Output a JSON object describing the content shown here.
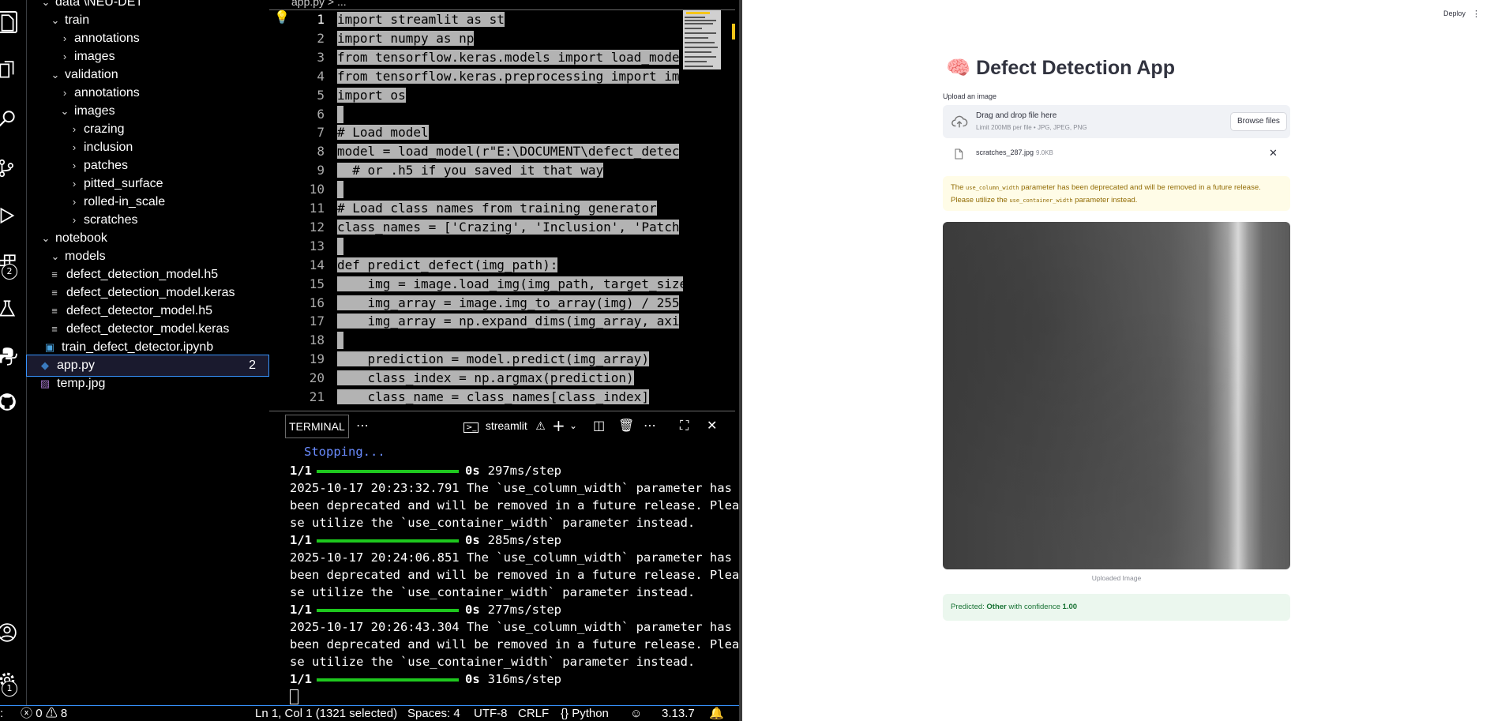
{
  "explorer": {
    "items": [
      {
        "label": "data \\NEU-DET",
        "type": "folder-open"
      },
      {
        "label": "train",
        "type": "folder-open"
      },
      {
        "label": "annotations",
        "type": "folder"
      },
      {
        "label": "images",
        "type": "folder"
      },
      {
        "label": "validation",
        "type": "folder-open"
      },
      {
        "label": "annotations",
        "type": "folder"
      },
      {
        "label": "images",
        "type": "folder-open"
      },
      {
        "label": "crazing",
        "type": "folder"
      },
      {
        "label": "inclusion",
        "type": "folder"
      },
      {
        "label": "patches",
        "type": "folder"
      },
      {
        "label": "pitted_surface",
        "type": "folder"
      },
      {
        "label": "rolled-in_scale",
        "type": "folder"
      },
      {
        "label": "scratches",
        "type": "folder"
      },
      {
        "label": "notebook",
        "type": "folder-open"
      },
      {
        "label": "models",
        "type": "folder-open"
      },
      {
        "label": "defect_detection_model.h5",
        "type": "file"
      },
      {
        "label": "defect_detection_model.keras",
        "type": "file"
      },
      {
        "label": "defect_detector_model.h5",
        "type": "file"
      },
      {
        "label": "defect_detector_model.keras",
        "type": "file"
      },
      {
        "label": "train_defect_detector.ipynb",
        "type": "notebook"
      },
      {
        "label": "app.py",
        "type": "python",
        "badge": "2"
      },
      {
        "label": "temp.jpg",
        "type": "image"
      }
    ]
  },
  "activity": {
    "icons": [
      "explorer-icon",
      "files-icon",
      "search-icon",
      "source-control-icon",
      "run-debug-icon",
      "extensions-icon",
      "testing-icon",
      "python-icon",
      "github-icon",
      "account-icon",
      "settings-icon"
    ],
    "extensions_badge": "2",
    "settings_badge": "1"
  },
  "editor": {
    "breadcrumb": "app.py > ...",
    "lines": [
      "import streamlit as st",
      "import numpy as np",
      "from tensorflow.keras.models import load_mode",
      "from tensorflow.keras.preprocessing import im",
      "import os",
      "",
      "# Load model",
      "model = load_model(r\"E:\\DOCUMENT\\defect_detec",
      "  # or .h5 if you saved it that way",
      "",
      "# Load class names from training generator",
      "class_names = ['Crazing', 'Inclusion', 'Patch",
      "",
      "def predict_defect(img_path):",
      "    img = image.load_img(img_path, target_size",
      "    img_array = image.img_to_array(img) / 255",
      "    img_array = np.expand_dims(img_array, axi",
      "",
      "    prediction = model.predict(img_array)",
      "    class_index = np.argmax(prediction)",
      "    class_name = class_names[class_index]"
    ]
  },
  "terminal": {
    "tab_label": "TERMINAL",
    "shell_label": "streamlit",
    "stopping": "Stopping...",
    "lines": [
      {
        "kind": "progress",
        "count": "1/1",
        "time": "0s",
        "rate": "297ms/step"
      },
      {
        "kind": "text",
        "text": "2025-10-17 20:23:32.791 The `use_column_width` parameter has"
      },
      {
        "kind": "text",
        "text": "been deprecated and will be removed in a future release. Plea"
      },
      {
        "kind": "text",
        "text": "se utilize the `use_container_width` parameter instead."
      },
      {
        "kind": "progress",
        "count": "1/1",
        "time": "0s",
        "rate": "285ms/step"
      },
      {
        "kind": "text",
        "text": "2025-10-17 20:24:06.851 The `use_column_width` parameter has"
      },
      {
        "kind": "text",
        "text": "been deprecated and will be removed in a future release. Plea"
      },
      {
        "kind": "text",
        "text": "se utilize the `use_container_width` parameter instead."
      },
      {
        "kind": "progress",
        "count": "1/1",
        "time": "0s",
        "rate": "277ms/step"
      },
      {
        "kind": "text",
        "text": "2025-10-17 20:26:43.304 The `use_column_width` parameter has"
      },
      {
        "kind": "text",
        "text": "been deprecated and will be removed in a future release. Plea"
      },
      {
        "kind": "text",
        "text": "se utilize the `use_container_width` parameter instead."
      },
      {
        "kind": "progress",
        "count": "1/1",
        "time": "0s",
        "rate": "316ms/step"
      }
    ]
  },
  "status": {
    "errors": "0",
    "warnings": "8",
    "position": "Ln 1, Col 1 (1321 selected)",
    "spaces": "Spaces: 4",
    "encoding": "UTF-8",
    "eol": "CRLF",
    "language": "Python",
    "version": "3.13.7"
  },
  "streamlit": {
    "deploy": "Deploy",
    "menu": "⋮",
    "title": "Defect Detection App",
    "title_emoji": "🧠",
    "upload_label": "Upload an image",
    "drop_text": "Drag and drop file here",
    "drop_limit": "Limit 200MB per file • JPG, JPEG, PNG",
    "browse": "Browse files",
    "file_name": "scratches_287.jpg",
    "file_size": "9.0KB",
    "warning_p1": "The ",
    "warning_code1": "use_column_width",
    "warning_p2": " parameter has been deprecated and will be removed in a future release. Please utilize the ",
    "warning_code2": "use_container_width",
    "warning_p3": " parameter instead.",
    "caption": "Uploaded Image",
    "pred_prefix": "Predicted: ",
    "pred_class": "Other",
    "pred_mid": " with confidence ",
    "pred_conf": "1.00",
    "colors": {
      "warning_bg": "#fffce7",
      "warning_text": "#926c05",
      "success_bg": "#ebf7ee",
      "success_text": "#177233",
      "uploader_bg": "#f0f2f6"
    }
  }
}
